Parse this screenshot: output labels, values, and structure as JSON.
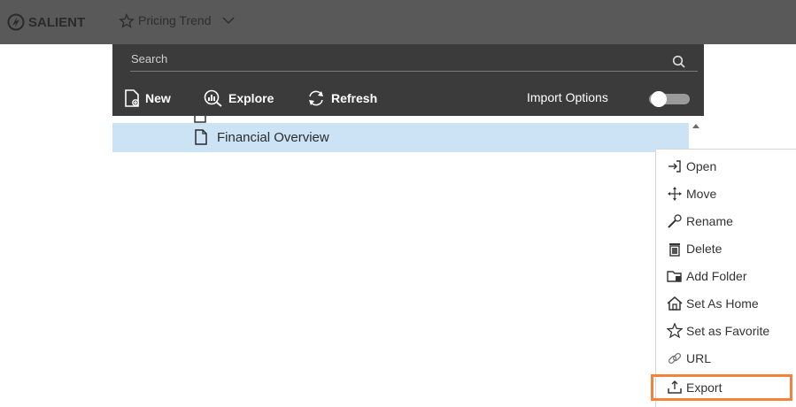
{
  "topbar": {
    "brand": "SALIENT",
    "page_title": "Pricing Trend"
  },
  "panel": {
    "search_placeholder": "Search",
    "actions": {
      "new_label": "New",
      "explore_label": "Explore",
      "refresh_label": "Refresh"
    },
    "import_options_label": "Import Options",
    "import_options_on": false
  },
  "tree": {
    "selected_item": "Financial Overview"
  },
  "context_menu": {
    "items": [
      {
        "label": "Open",
        "icon": "open-icon"
      },
      {
        "label": "Move",
        "icon": "move-icon"
      },
      {
        "label": "Rename",
        "icon": "rename-icon"
      },
      {
        "label": "Delete",
        "icon": "delete-icon"
      },
      {
        "label": "Add Folder",
        "icon": "add-folder-icon"
      },
      {
        "label": "Set As Home",
        "icon": "home-icon"
      },
      {
        "label": "Set as Favorite",
        "icon": "star-icon"
      },
      {
        "label": "URL",
        "icon": "link-icon"
      },
      {
        "label": "Export",
        "icon": "export-icon"
      }
    ],
    "highlighted": "Export"
  },
  "colors": {
    "topbar": "#595959",
    "panel": "#3b3b3b",
    "selection": "#cce3f6",
    "highlight_border": "#f4823a"
  }
}
